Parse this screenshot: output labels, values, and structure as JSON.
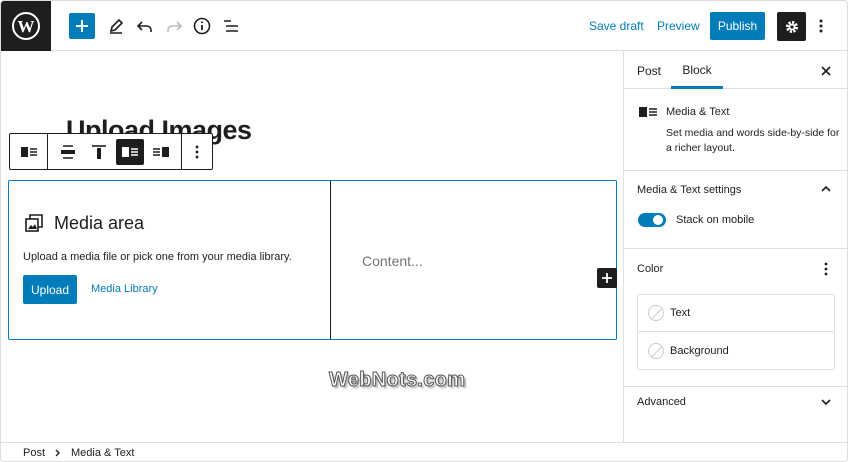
{
  "topbar": {
    "save_draft": "Save draft",
    "preview": "Preview",
    "publish": "Publish"
  },
  "editor": {
    "post_title": "Upload Images",
    "media_area": {
      "title": "Media area",
      "description": "Upload a media file or pick one from your media library.",
      "upload_label": "Upload",
      "media_library_label": "Media Library"
    },
    "content_placeholder": "Content..."
  },
  "watermark": "WebNots.com",
  "sidebar": {
    "tabs": [
      "Post",
      "Block"
    ],
    "active_tab": "Block",
    "block_card": {
      "title": "Media & Text",
      "description": "Set media and words side-by-side for a richer layout."
    },
    "settings_panel": {
      "title": "Media & Text settings",
      "toggle_label": "Stack on mobile",
      "toggle_on": true
    },
    "color_panel": {
      "title": "Color",
      "items": [
        "Text",
        "Background"
      ]
    },
    "advanced_panel": {
      "title": "Advanced"
    }
  },
  "footer": {
    "breadcrumb": [
      "Post",
      "Media & Text"
    ]
  },
  "colors": {
    "accent": "#007cba",
    "dark": "#1e1e1e",
    "border": "#e0e0e0"
  },
  "icons": [
    "wordpress-logo-icon",
    "plus-icon",
    "pencil-icon",
    "undo-icon",
    "redo-icon",
    "info-icon",
    "list-view-icon",
    "gear-icon",
    "more-vertical-icon",
    "close-icon",
    "chevron-up-icon",
    "chevron-down-icon",
    "chevron-right-icon",
    "media-text-icon",
    "media-gallery-icon"
  ]
}
